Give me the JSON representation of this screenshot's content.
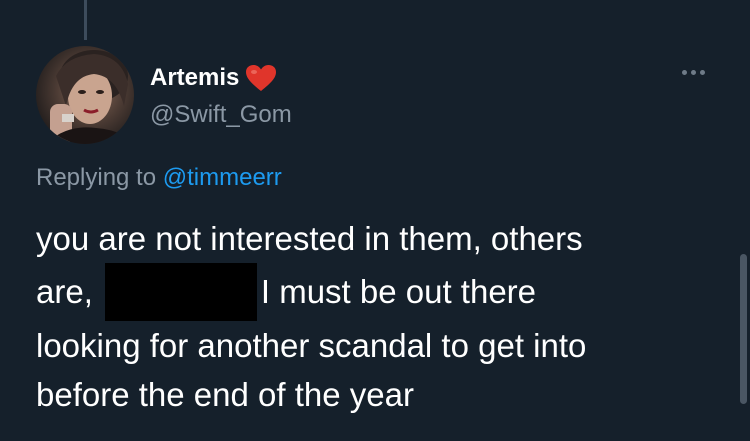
{
  "tweet": {
    "display_name": "Artemis",
    "name_emoji_icon": "red-heart-icon",
    "handle": "@Swift_Gom",
    "replying_prefix": "Replying to",
    "replying_mention": "@timmeerr",
    "text_lines": [
      "you are not interested in them, others",
      "are,",
      "I must be out there",
      "looking for another scandal to get into",
      "before the end of the year"
    ]
  },
  "icons": {
    "more": "more-options-icon"
  },
  "colors": {
    "background": "#15202b",
    "text_primary": "#ffffff",
    "text_secondary": "#8b98a5",
    "link": "#1d9bf0",
    "heart": "#e0352b",
    "redaction": "#000000"
  }
}
